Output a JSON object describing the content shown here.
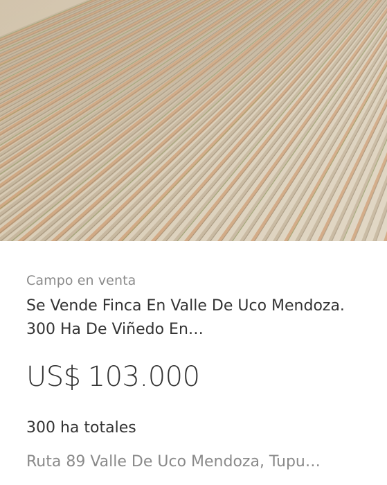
{
  "listing": {
    "photo_alt": "vineyard-rows-aerial",
    "category": "Campo en venta",
    "title": "Se Vende Finca En Valle De Uco Mendoza. 300 Ha De Viñedo En…",
    "price_currency": "US$",
    "price_amount": "103.000",
    "area": "300 ha totales",
    "location": "Ruta 89 Valle De Uco Mendoza, Tupu…"
  },
  "colors": {
    "text_primary": "#333333",
    "text_secondary": "#8a8a8a",
    "soil_light": "#d8ccb5",
    "soil_rust": "#c98a5a",
    "vine_green": "#7e8f52"
  }
}
